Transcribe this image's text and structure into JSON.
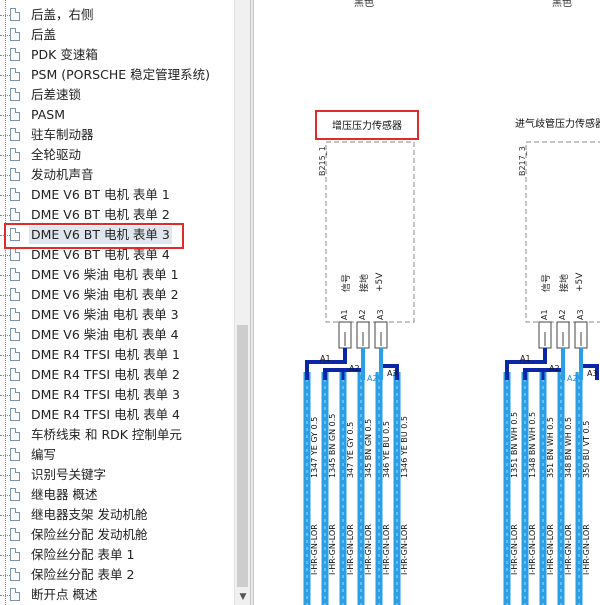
{
  "tree": {
    "items": [
      {
        "label": "后盖，右侧"
      },
      {
        "label": "后盖"
      },
      {
        "label": "PDK 变速箱"
      },
      {
        "label": "PSM (PORSCHE 稳定管理系统)"
      },
      {
        "label": "后差速锁"
      },
      {
        "label": "PASM"
      },
      {
        "label": "驻车制动器"
      },
      {
        "label": "全轮驱动"
      },
      {
        "label": "发动机声音"
      },
      {
        "label": "DME V6 BT 电机 表单 1"
      },
      {
        "label": "DME V6 BT 电机 表单 2"
      },
      {
        "label": "DME V6 BT 电机 表单 3",
        "selected": true
      },
      {
        "label": "DME V6 BT 电机 表单 4"
      },
      {
        "label": "DME V6 柴油 电机 表单 1"
      },
      {
        "label": "DME V6 柴油 电机 表单 2"
      },
      {
        "label": "DME V6 柴油 电机 表单 3"
      },
      {
        "label": "DME V6 柴油 电机 表单 4"
      },
      {
        "label": "DME R4 TFSI 电机 表单 1"
      },
      {
        "label": "DME R4 TFSI 电机 表单 2"
      },
      {
        "label": "DME R4 TFSI 电机 表单 3"
      },
      {
        "label": "DME R4 TFSI 电机 表单 4"
      },
      {
        "label": "车桥线束 和 RDK 控制单元"
      },
      {
        "label": "编写"
      },
      {
        "label": "识别号关键字"
      },
      {
        "label": "继电器 概述"
      },
      {
        "label": "继电器支架 发动机舱"
      },
      {
        "label": "保险丝分配 发动机舱"
      },
      {
        "label": "保险丝分配 表单 1"
      },
      {
        "label": "保险丝分配 表单 2"
      },
      {
        "label": "断开点 概述"
      }
    ]
  },
  "diagram": {
    "top_labels": [
      "黑色",
      "黑色"
    ],
    "sensors": [
      {
        "title": "增压压力传感器",
        "component_id": "B215_1",
        "pins": [
          {
            "name": "信号",
            "id": "A1"
          },
          {
            "name": "接地",
            "id": "A2"
          },
          {
            "name": "+5V",
            "id": "A3"
          }
        ],
        "connectors": [
          "A1",
          "A2",
          "A3"
        ],
        "wires": [
          "1347  YE GY  0.5",
          "1345  BN GN  0.5",
          "347  YE GY  0.5",
          "345  BN GN  0.5",
          "346  YE BU  0.5",
          "1346  YE BU  0.5"
        ],
        "harness": "I-HR-GN-LOR"
      },
      {
        "title": "进气歧管压力传感器",
        "component_id": "B217_3",
        "pins": [
          {
            "name": "信号",
            "id": "A1"
          },
          {
            "name": "接地",
            "id": "A2"
          },
          {
            "name": "+5V",
            "id": "A3"
          }
        ],
        "connectors": [
          "A1",
          "A2",
          "A3"
        ],
        "wires": [
          "1351  BN WH  0.5",
          "1348  BN WH  0.5",
          "351  BN WH  0.5",
          "348  BN WH  0.5",
          "350  BU VT  0.5"
        ],
        "harness": "I-HR-GN-LOR"
      }
    ],
    "colors": {
      "wire": "#2a9fe6",
      "wire_dark": "#0b27a8",
      "highlight": "#e02b2b"
    }
  }
}
